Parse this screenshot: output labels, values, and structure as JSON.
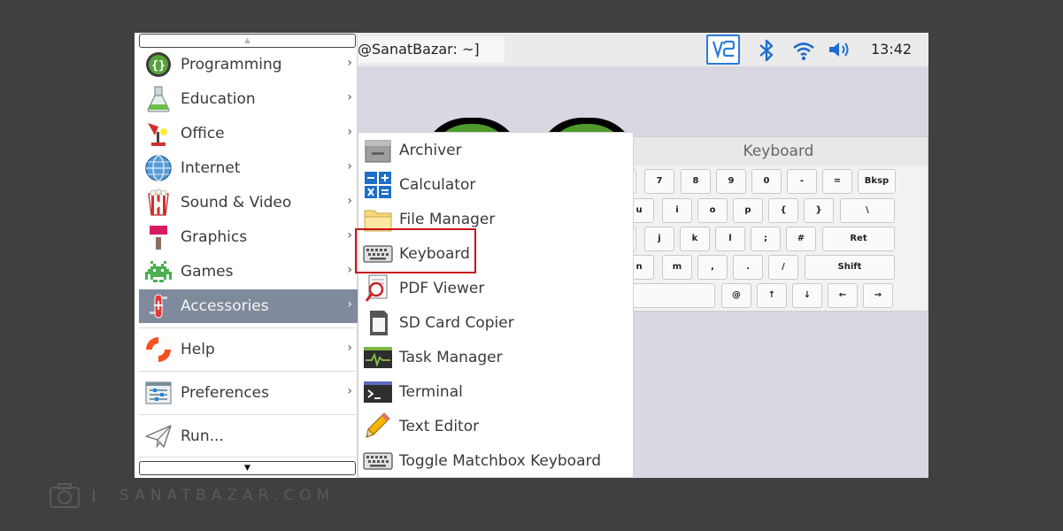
{
  "taskbar": {
    "terminal_title": "@SanatBazar: ~]",
    "clock": "13:42",
    "tray_icons": [
      "vnc-icon",
      "bluetooth-icon",
      "wifi-icon",
      "volume-icon"
    ]
  },
  "keyboard_window": {
    "title": "Keyboard",
    "rows": [
      [
        "7",
        "8",
        "9",
        "0",
        "-",
        "=",
        "Bksp"
      ],
      [
        "u",
        "i",
        "o",
        "p",
        "{",
        "}",
        "\\"
      ],
      [
        "j",
        "k",
        "l",
        ";",
        "#",
        "Ret"
      ],
      [
        "n",
        "m",
        ",",
        ".",
        "/",
        "Shift"
      ],
      [
        "@",
        "↑",
        "↓",
        "←",
        "→"
      ]
    ]
  },
  "main_menu": {
    "items": [
      {
        "label": "Programming",
        "icon": "programming-icon",
        "has_submenu": true,
        "active": false
      },
      {
        "label": "Education",
        "icon": "education-icon",
        "has_submenu": true,
        "active": false
      },
      {
        "label": "Office",
        "icon": "office-icon",
        "has_submenu": true,
        "active": false
      },
      {
        "label": "Internet",
        "icon": "internet-icon",
        "has_submenu": true,
        "active": false
      },
      {
        "label": "Sound & Video",
        "icon": "sound-video-icon",
        "has_submenu": true,
        "active": false
      },
      {
        "label": "Graphics",
        "icon": "graphics-icon",
        "has_submenu": true,
        "active": false
      },
      {
        "label": "Games",
        "icon": "games-icon",
        "has_submenu": true,
        "active": false
      },
      {
        "label": "Accessories",
        "icon": "accessories-icon",
        "has_submenu": true,
        "active": true
      },
      {
        "label": "Help",
        "icon": "help-icon",
        "has_submenu": true,
        "active": false
      },
      {
        "label": "Preferences",
        "icon": "preferences-icon",
        "has_submenu": true,
        "active": false
      },
      {
        "label": "Run...",
        "icon": "run-icon",
        "has_submenu": false,
        "active": false
      }
    ],
    "scroll_up_glyph": "▲",
    "scroll_down_glyph": "▼",
    "arrow_glyph": "›"
  },
  "accessories_menu": {
    "items": [
      {
        "label": "Archiver",
        "icon": "archiver-icon"
      },
      {
        "label": "Calculator",
        "icon": "calculator-icon"
      },
      {
        "label": "File Manager",
        "icon": "file-manager-icon"
      },
      {
        "label": "Keyboard",
        "icon": "keyboard-icon",
        "highlighted": true
      },
      {
        "label": "PDF Viewer",
        "icon": "pdf-viewer-icon"
      },
      {
        "label": "SD Card Copier",
        "icon": "sd-card-icon"
      },
      {
        "label": "Task Manager",
        "icon": "task-manager-icon"
      },
      {
        "label": "Terminal",
        "icon": "terminal-icon"
      },
      {
        "label": "Text Editor",
        "icon": "text-editor-icon"
      },
      {
        "label": "Toggle Matchbox Keyboard",
        "icon": "keyboard-icon"
      }
    ],
    "highlight_color": "#c8151b"
  },
  "watermark": {
    "text": "SANATBAZAR.COM",
    "icon": "camera-icon"
  }
}
